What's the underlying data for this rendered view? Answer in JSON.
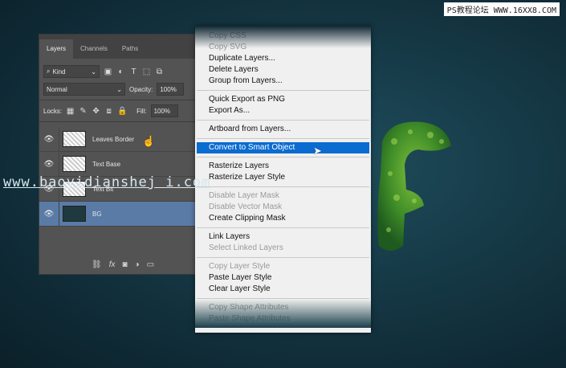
{
  "watermarks": {
    "top": "PS教程论坛 WWW.16XX8.COM",
    "middle": "www.baoyidianshej i.com"
  },
  "panel": {
    "tabs": [
      "Layers",
      "Channels",
      "Paths"
    ],
    "filter_kind": "Kind",
    "blend_mode": "Normal",
    "opacity_label": "Opacity:",
    "opacity_value": "100%",
    "locks_label": "Locks:",
    "fill_label": "Fill:",
    "fill_value": "100%",
    "layers": [
      {
        "name": "Leaves Border",
        "thumb": "pattern",
        "selected": false
      },
      {
        "name": "Text Base",
        "thumb": "pattern",
        "selected": false
      },
      {
        "name": "Text Bit",
        "thumb": "pattern",
        "selected": false
      },
      {
        "name": "BG",
        "thumb": "dark",
        "selected": true
      }
    ],
    "bottom_icons": [
      "link-icon",
      "fx-icon",
      "mask-icon",
      "adjustment-icon",
      "folder-icon"
    ]
  },
  "menu": {
    "items": [
      {
        "label": "Copy CSS",
        "disabled": true
      },
      {
        "label": "Copy SVG",
        "disabled": true
      },
      {
        "label": "Duplicate Layers...",
        "disabled": false
      },
      {
        "label": "Delete Layers",
        "disabled": false
      },
      {
        "label": "Group from Layers...",
        "disabled": false
      },
      {
        "sep": true
      },
      {
        "label": "Quick Export as PNG",
        "disabled": false
      },
      {
        "label": "Export As...",
        "disabled": false
      },
      {
        "sep": true
      },
      {
        "label": "Artboard from Layers...",
        "disabled": false
      },
      {
        "sep": true
      },
      {
        "label": "Convert to Smart Object",
        "disabled": false,
        "highlighted": true
      },
      {
        "sep": true
      },
      {
        "label": "Rasterize Layers",
        "disabled": false
      },
      {
        "label": "Rasterize Layer Style",
        "disabled": false
      },
      {
        "sep": true
      },
      {
        "label": "Disable Layer Mask",
        "disabled": true
      },
      {
        "label": "Disable Vector Mask",
        "disabled": true
      },
      {
        "label": "Create Clipping Mask",
        "disabled": false
      },
      {
        "sep": true
      },
      {
        "label": "Link Layers",
        "disabled": false
      },
      {
        "label": "Select Linked Layers",
        "disabled": true
      },
      {
        "sep": true
      },
      {
        "label": "Copy Layer Style",
        "disabled": true
      },
      {
        "label": "Paste Layer Style",
        "disabled": false
      },
      {
        "label": "Clear Layer Style",
        "disabled": false
      },
      {
        "sep": true
      },
      {
        "label": "Copy Shape Attributes",
        "disabled": true
      },
      {
        "label": "Paste Shape Attributes",
        "disabled": true
      }
    ]
  },
  "colors": {
    "accent": "#0a6bd0",
    "panel": "#535353",
    "selected_layer": "#5a7ba6"
  }
}
